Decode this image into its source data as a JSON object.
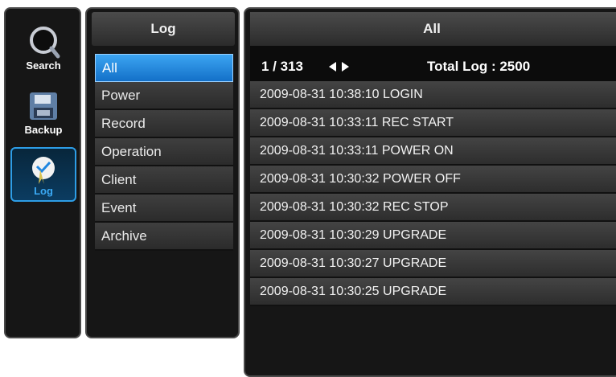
{
  "nav": {
    "search_label": "Search",
    "backup_label": "Backup",
    "log_label": "Log"
  },
  "categories": {
    "title": "Log",
    "items": [
      "All",
      "Power",
      "Record",
      "Operation",
      "Client",
      "Event",
      "Archive"
    ],
    "selected": "All"
  },
  "log": {
    "title": "All",
    "page": "1 / 313",
    "total": "Total Log : 2500",
    "entries": [
      "2009-08-31 10:38:10 LOGIN",
      "2009-08-31 10:33:11 REC START",
      "2009-08-31 10:33:11 POWER ON",
      "2009-08-31 10:30:32 POWER OFF",
      "2009-08-31 10:30:32 REC STOP",
      "2009-08-31 10:30:29 UPGRADE",
      "2009-08-31 10:30:27 UPGRADE",
      "2009-08-31 10:30:25 UPGRADE"
    ]
  },
  "colors": {
    "accent": "#2d9de6",
    "selected": "#1f86e0",
    "panel": "#161616"
  }
}
